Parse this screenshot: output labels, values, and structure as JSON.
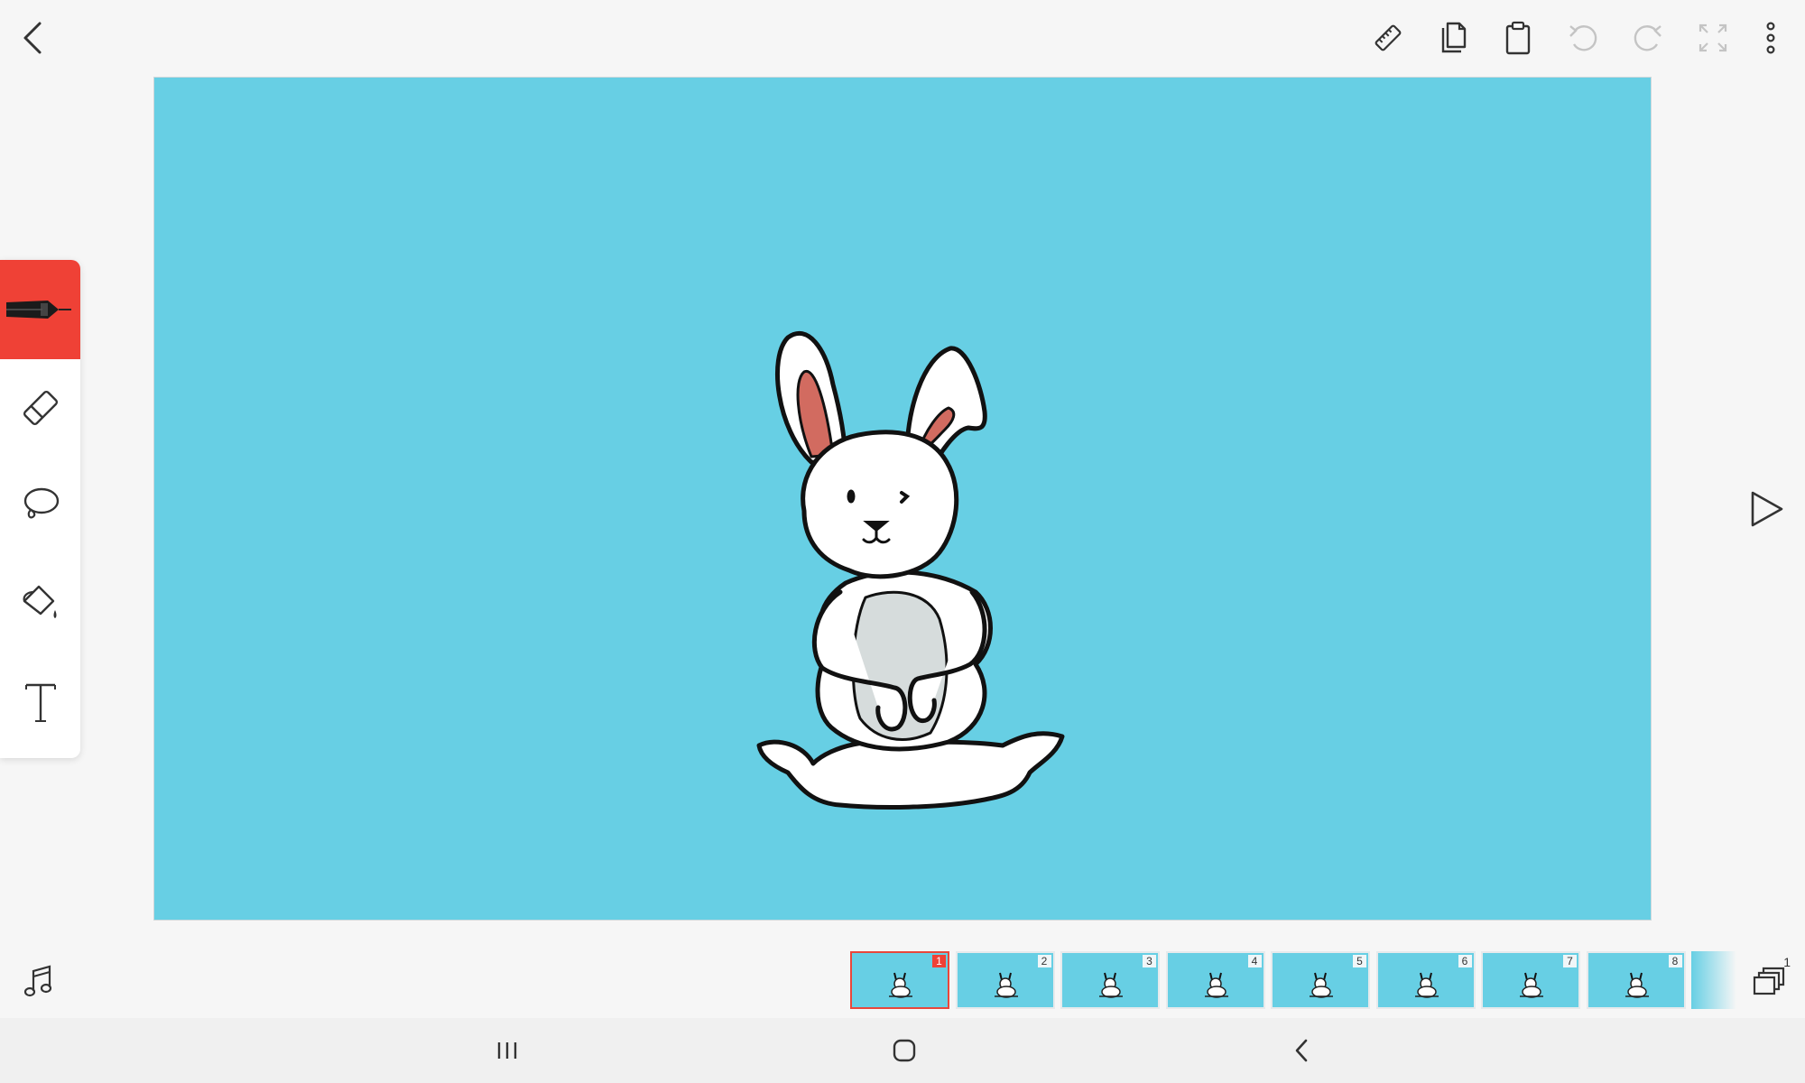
{
  "app": {
    "top_toolbar": {
      "icons": [
        "back-arrow-icon",
        "ruler-icon",
        "copy-icon",
        "paste-clipboard-icon",
        "undo-icon",
        "redo-icon",
        "fullscreen-icon",
        "more-vertical-icon"
      ]
    },
    "tools": {
      "items": [
        "pen-icon",
        "eraser-icon",
        "lasso-icon",
        "paint-bucket-icon",
        "text-tool-icon"
      ],
      "active": "pen-icon",
      "accent_color": "#ef4136"
    },
    "canvas": {
      "background_color": "#67cfe4"
    },
    "play": {
      "icon": "play-icon"
    },
    "music": {
      "icon": "music-note-icon"
    },
    "timeline": {
      "frames": [
        {
          "number": "1",
          "selected": true
        },
        {
          "number": "2",
          "selected": false
        },
        {
          "number": "3",
          "selected": false
        },
        {
          "number": "4",
          "selected": false
        },
        {
          "number": "5",
          "selected": false
        },
        {
          "number": "6",
          "selected": false
        },
        {
          "number": "7",
          "selected": false
        },
        {
          "number": "8",
          "selected": false
        }
      ],
      "layers_label": "1"
    },
    "system_nav": {
      "icons": [
        "recent-apps-icon",
        "home-icon",
        "nav-back-icon"
      ]
    }
  }
}
